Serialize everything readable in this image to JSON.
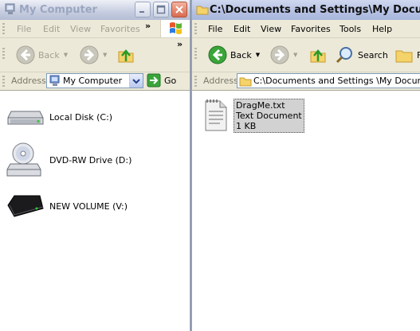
{
  "left_window": {
    "title": "My Computer",
    "menu": [
      "File",
      "Edit",
      "View",
      "Favorites"
    ],
    "more_chevron": "»",
    "toolbar": {
      "back_label": "Back",
      "more_chevron": "»"
    },
    "address": {
      "label": "Address",
      "value": "My Computer",
      "go_label": "Go"
    },
    "drives": [
      {
        "label": "Local Disk (C:)",
        "icon": "hard-disk-icon"
      },
      {
        "label": "DVD-RW Drive (D:)",
        "icon": "dvd-drive-icon"
      },
      {
        "label": "NEW VOLUME (V:)",
        "icon": "external-drive-icon"
      }
    ]
  },
  "right_window": {
    "title": "C:\\Documents and Settings\\My Documents",
    "menu": [
      "File",
      "Edit",
      "View",
      "Favorites",
      "Tools",
      "Help"
    ],
    "toolbar": {
      "back_label": "Back",
      "search_label": "Search",
      "folders_label": "F"
    },
    "address": {
      "label": "Address",
      "value": "C:\\Documents and Settings \\My Documents"
    },
    "files": [
      {
        "name": "DragMe.txt",
        "type": "Text Document",
        "size": "1 KB",
        "icon": "text-file-icon"
      }
    ]
  }
}
